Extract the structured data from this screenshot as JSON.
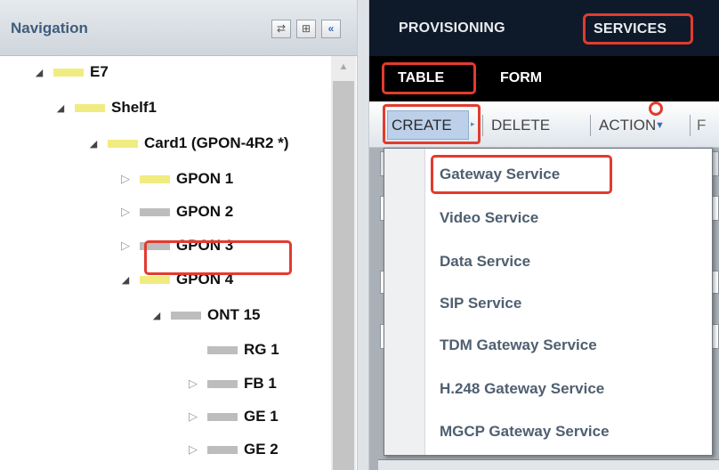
{
  "navigation": {
    "title": "Navigation",
    "tree": [
      {
        "label": "E7",
        "toggle": "expanded",
        "icon": "folder-yellow-icon"
      },
      {
        "label": "Shelf1",
        "toggle": "expanded",
        "icon": "folder-yellow-icon"
      },
      {
        "label": "Card1 (GPON-4R2 *)",
        "toggle": "expanded",
        "icon": "folder-yellow-icon"
      },
      {
        "label": "GPON 1",
        "toggle": "collapsed",
        "icon": "folder-yellow-icon"
      },
      {
        "label": "GPON 2",
        "toggle": "collapsed",
        "icon": "folder-gray-icon"
      },
      {
        "label": "GPON 3",
        "toggle": "collapsed",
        "icon": "folder-gray-icon"
      },
      {
        "label": "GPON 4",
        "toggle": "expanded",
        "icon": "folder-yellow-icon"
      },
      {
        "label": "ONT 15",
        "toggle": "expanded",
        "icon": "folder-gray-icon",
        "selected": true
      },
      {
        "label": "RG 1",
        "toggle": "none",
        "icon": "folder-gray-icon"
      },
      {
        "label": "FB 1",
        "toggle": "collapsed",
        "icon": "folder-gray-icon"
      },
      {
        "label": "GE 1",
        "toggle": "collapsed",
        "icon": "folder-gray-icon"
      },
      {
        "label": "GE 2",
        "toggle": "collapsed",
        "icon": "folder-gray-icon"
      }
    ]
  },
  "top_tabs": {
    "provisioning": "PROVISIONING",
    "services": "SERVICES"
  },
  "sub_tabs": {
    "table": "TABLE",
    "form": "FORM"
  },
  "toolbar": {
    "create": "CREATE",
    "delete": "DELETE",
    "action": "ACTION",
    "partial": "F"
  },
  "create_menu": {
    "items": [
      "Gateway Service",
      "Video Service",
      "Data Service",
      "SIP Service",
      "TDM Gateway Service",
      "H.248 Gateway Service",
      "MGCP Gateway Service"
    ]
  },
  "colors": {
    "highlight": "#e23b2e",
    "nav_title": "#3f5d7d",
    "tab_bar": "#0e1a2a"
  }
}
